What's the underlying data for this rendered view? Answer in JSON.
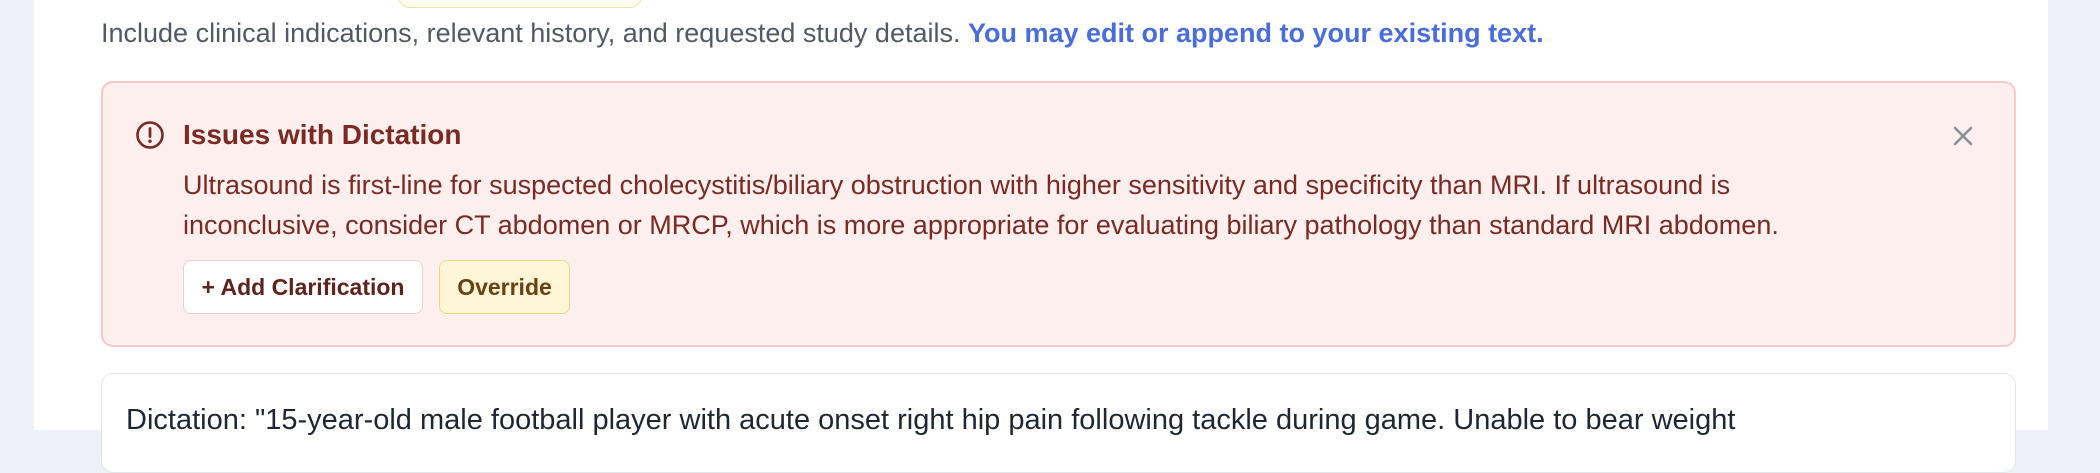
{
  "instructions": {
    "text": "Include clinical indications, relevant history, and requested study details.",
    "emphasis": "You may edit or append to your existing text."
  },
  "alert": {
    "title": "Issues with Dictation",
    "icon": "exclamation-circle-icon",
    "close_icon": "close-icon",
    "body": "Ultrasound is first-line for suspected cholecystitis/biliary obstruction with higher sensitivity and specificity than MRI. If ultrasound is inconclusive, consider CT abdomen or MRCP, which is more appropriate for evaluating biliary pathology than standard MRI abdomen.",
    "add_clarification_label": "+ Add Clarification",
    "override_label": "Override"
  },
  "dictation": {
    "text": "Dictation: \"15-year-old male football player with acute onset right hip pain following tackle during game. Unable to bear weight"
  },
  "colors": {
    "alert_background": "#fcefee",
    "alert_border": "#f5c9c6",
    "alert_text": "#7a2a22",
    "link_blue": "#4a6cdc",
    "override_background": "#fff6d8"
  }
}
